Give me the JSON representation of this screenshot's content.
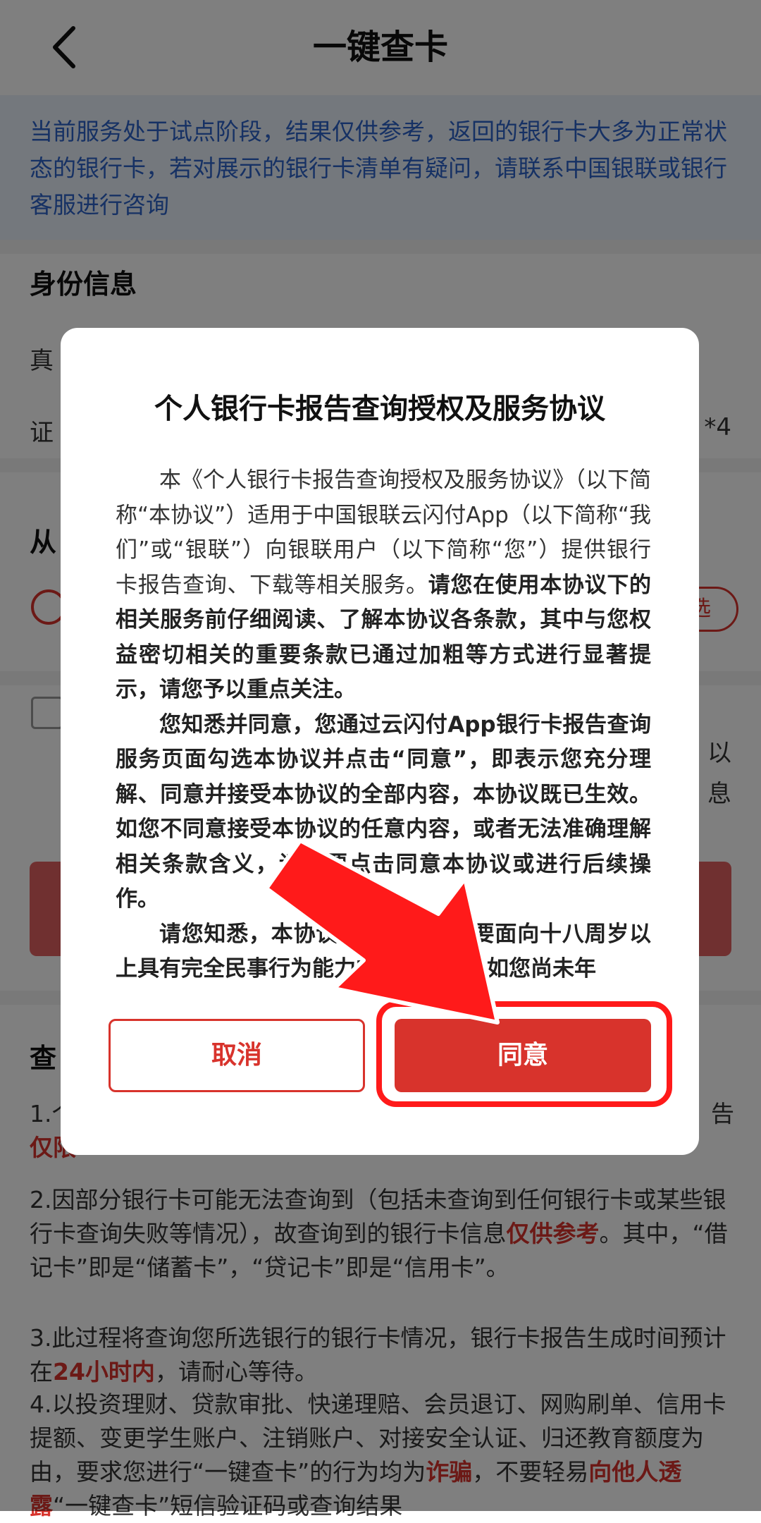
{
  "header": {
    "title": "一键查卡"
  },
  "notice": {
    "text": "当前服务处于试点阶段，结果仅供参考，返回的银行卡大多为正常状态的银行卡，若对展示的银行卡清单有疑问，请联系中国银联或银行客服进行咨询"
  },
  "identity": {
    "title": "身份信息",
    "name_label_fragment": "真",
    "id_label_fragment": "证",
    "id_value_fragment": "*4"
  },
  "bank_section": {
    "title_fragment": "从",
    "select_fragment": "选"
  },
  "agreement_fragment": {
    "line1": "以",
    "line2": "息"
  },
  "notes": {
    "title_fragment": "查",
    "item1_start": "1.个",
    "item1_end": "告",
    "item1_highlight_fragment": "仅限",
    "item2_a": "2.因部分银行卡可能无法查询到（包括未查询到任何银行卡或某些银行卡查询失败等情况），故查询到的银行卡信息",
    "item2_hl": "仅供参考",
    "item2_b": "。其中，“借记卡”即是“储蓄卡”，“贷记卡”即是“信用卡”。",
    "item3_a": "3.此过程将查询您所选银行的银行卡情况，银行卡报告生成时间预计在",
    "item3_hl": "24小时内",
    "item3_b": "，请耐心等待。",
    "item4_a": "4.以投资理财、贷款审批、快递理赔、会员退订、网购刷单、信用卡提额、变更学生账户、注销账户、对接安全认证、归还教育额度为由，要求您进行“一键查卡”的行为均为",
    "item4_hl1": "诈骗",
    "item4_b": "，不要轻易",
    "item4_hl2": "向他人透露",
    "item4_c": "“一键查卡”短信验证码或查询结果"
  },
  "modal": {
    "title": "个人银行卡报告查询授权及服务协议",
    "p1_normal": "本《个人银行卡报告查询授权及服务协议》（以下简称“本协议”）适用于中国银联云闪付App（以下简称“我们”或“银联”）向银联用户（以下简称“您”）提供银行卡报告查询、下载等相关服务。",
    "p1_bold": "请您在使用本协议下的相关服务前仔细阅读、了解本协议各条款，其中与您权益密切相关的重要条款已通过加粗等方式进行显著提示，请您予以重点关注。",
    "p2_bold": "您知悉并同意，您通过云闪付App银行卡报告查询服务页面勾选本协议并点击“同意”，即表示您充分理解、同意并接受本协议的全部内容，本协议既已生效。如您不同意接受本协议的任意内容，或者无法准确理解相关条款含义，请不要点击同意本协议或进行后续操作。",
    "p3_bold": "请您知悉，本协议及相关服务主要面向十八周岁以上具有完全民事行为能力的用户提供。如您尚未年",
    "cancel_label": "取消",
    "confirm_label": "同意"
  },
  "colors": {
    "accent_red": "#d8332c",
    "notice_blue": "#2d62c8",
    "notice_bg": "#e9f1fb",
    "annotation_red": "#ff1a1a"
  }
}
